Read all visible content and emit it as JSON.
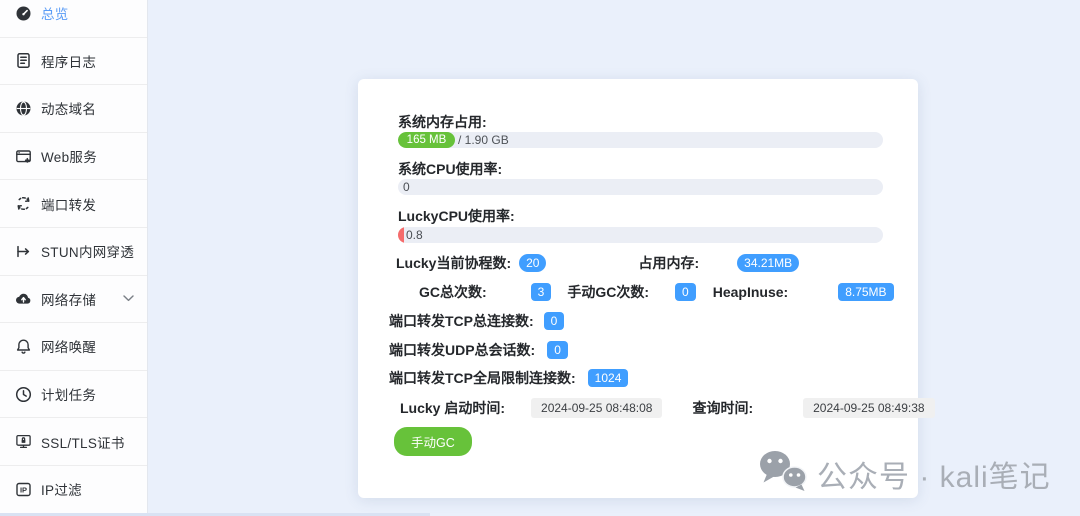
{
  "sidebar": {
    "items": [
      {
        "label": "总览",
        "icon": "gauge-icon",
        "active": true
      },
      {
        "label": "程序日志",
        "icon": "log-icon"
      },
      {
        "label": "动态域名",
        "icon": "globe-icon"
      },
      {
        "label": "Web服务",
        "icon": "web-service-icon"
      },
      {
        "label": "端口转发",
        "icon": "port-forward-icon"
      },
      {
        "label": "STUN内网穿透",
        "icon": "stun-icon"
      },
      {
        "label": "网络存储",
        "icon": "cloud-upload-icon",
        "expandable": true
      },
      {
        "label": "网络唤醒",
        "icon": "bell-icon"
      },
      {
        "label": "计划任务",
        "icon": "clock-icon"
      },
      {
        "label": "SSL/TLS证书",
        "icon": "certificate-icon"
      },
      {
        "label": "IP过滤",
        "icon": "ip-filter-icon"
      }
    ]
  },
  "main": {
    "memory": {
      "label": "系统内存占用:",
      "used": "165 MB",
      "total_suffix": "/ 1.90 GB",
      "percent": 8.5
    },
    "system_cpu": {
      "label": "系统CPU使用率:",
      "value": "0"
    },
    "lucky_cpu": {
      "label": "LuckyCPU使用率:",
      "value": "0.8"
    },
    "goroutines": {
      "label": "Lucky当前协程数:",
      "value": "20"
    },
    "lucky_memory": {
      "label": "占用内存:",
      "value": "34.21MB"
    },
    "gc_total": {
      "label": "GC总次数:",
      "value": "3"
    },
    "gc_manual": {
      "label": "手动GC次数:",
      "value": "0"
    },
    "heap_inuse": {
      "label": "HeapInuse:",
      "value": "8.75MB"
    },
    "tcp_connections": {
      "label": "端口转发TCP总连接数:",
      "value": "0"
    },
    "udp_sessions": {
      "label": "端口转发UDP总会话数:",
      "value": "0"
    },
    "tcp_global_limit": {
      "label": "端口转发TCP全局限制连接数:",
      "value": "1024"
    },
    "start_time": {
      "label": "Lucky 启动时间:",
      "value": "2024-09-25 08:48:08"
    },
    "query_time": {
      "label": "查询时间:",
      "value": "2024-09-25 08:49:38"
    },
    "manual_gc_button": "手动GC"
  },
  "watermark": {
    "text": "公众号 · kali笔记"
  },
  "colors": {
    "primary_badge": "#409eff",
    "success_green": "#67c23a",
    "danger_red": "#f56c6c",
    "active_link_blue": "#5a9cf6",
    "progress_track": "#ebeef5",
    "page_background": "#eaf0fb"
  }
}
